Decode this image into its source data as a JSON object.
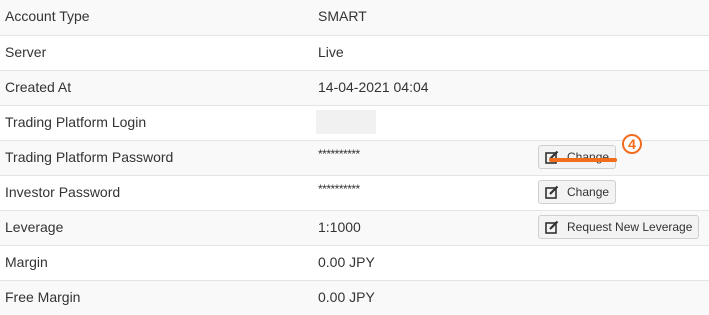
{
  "rows": [
    {
      "label": "Account Type",
      "value": "SMART"
    },
    {
      "label": "Server",
      "value": "Live"
    },
    {
      "label": "Created At",
      "value": "14-04-2021 04:04"
    },
    {
      "label": "Trading Platform Login",
      "value": ""
    },
    {
      "label": "Trading Platform Password",
      "value": "**********",
      "button": "Change"
    },
    {
      "label": "Investor Password",
      "value": "**********",
      "button": "Change"
    },
    {
      "label": "Leverage",
      "value": "1:1000",
      "button": "Request New Leverage"
    },
    {
      "label": "Margin",
      "value": "0.00 JPY"
    },
    {
      "label": "Free Margin",
      "value": "0.00 JPY"
    }
  ],
  "annotation": {
    "number": "4",
    "color": "#f36b1c"
  },
  "icons": {
    "button_icon": "edit-icon"
  }
}
